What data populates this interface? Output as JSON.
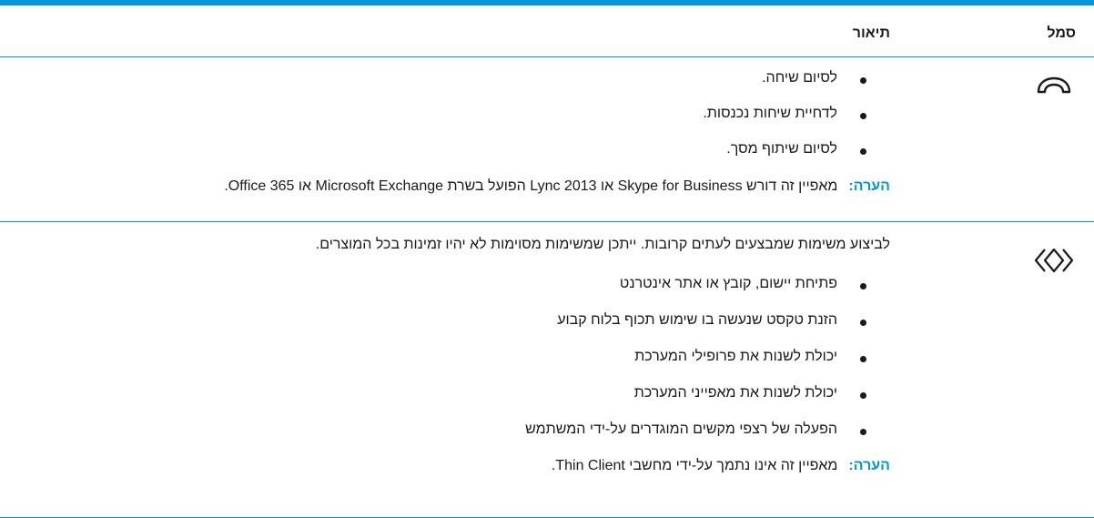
{
  "header": {
    "symbol": "סמל",
    "description": "תיאור"
  },
  "rows": [
    {
      "icon": "phone-hang-up-icon",
      "bullets": [
        "לסיום שיחה.",
        "לדחיית שיחות נכנסות.",
        "לסיום שיתוף מסך."
      ],
      "note_label": "הערה:",
      "note_text": "מאפיין זה דורש Skype for Business או Lync 2013 הפועל בשרת Microsoft Exchange או Office 365."
    },
    {
      "icon": "diamonds-programmable-key-icon",
      "intro": "לביצוע משימות שמבצעים לעתים קרובות. ייתכן שמשימות מסוימות לא יהיו זמינות בכל המוצרים.",
      "bullets": [
        "פתיחת יישום, קובץ או אתר אינטרנט",
        "הזנת טקסט שנעשה בו שימוש תכוף בלוח קבוע",
        "יכולת לשנות את פרופילי המערכת",
        "יכולת לשנות את מאפייני המערכת",
        "הפעלה של רצפי מקשים המוגדרים על-ידי המשתמש"
      ],
      "note_label": "הערה:",
      "note_text": "מאפיין זה אינו נתמך על-ידי מחשבי Thin Client."
    }
  ],
  "colors": {
    "accent": "#0096d6",
    "text": "#1a1a1a"
  }
}
